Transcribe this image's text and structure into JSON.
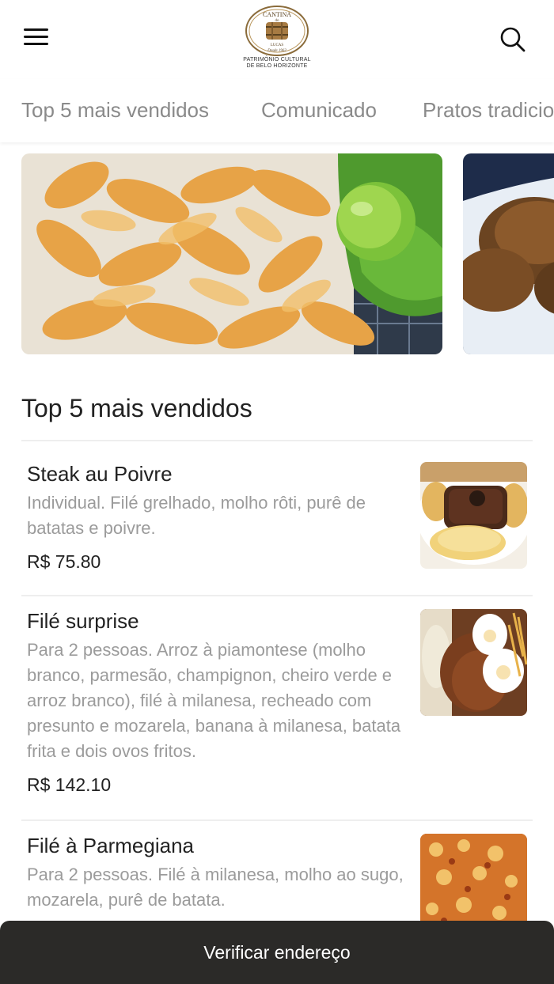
{
  "header": {
    "logo_text": "CANTINA do LUCAS",
    "logo_since": "Desde 1962",
    "logo_tagline_1": "PATRIMÔNIO CULTURAL",
    "logo_tagline_2": "DE BELO HORIZONTE",
    "menu_icon": "hamburger-menu-icon",
    "search_icon": "search-icon"
  },
  "tabs": [
    {
      "label": "Top 5 mais vendidos"
    },
    {
      "label": "Comunicado"
    },
    {
      "label": "Pratos tradicionais"
    }
  ],
  "carousel": {
    "slides": [
      {
        "image": "fried-fish-platter"
      },
      {
        "image": "breaded-croquettes"
      }
    ]
  },
  "section": {
    "title": "Top 5 mais vendidos"
  },
  "items": [
    {
      "name": "Steak au Poivre",
      "description": "Individual. Filé grelhado, molho rôti, purê de batatas e poivre.",
      "price": "R$ 75.80"
    },
    {
      "name": "Filé surprise",
      "description": "Para 2 pessoas. Arroz à piamontese (molho branco, parmesão, champignon, cheiro verde e arroz branco), filé à milanesa, recheado com presunto e mozarela, banana à milanesa, batata frita e dois ovos fritos.",
      "price": "R$ 142.10"
    },
    {
      "name": "Filé à Parmegiana",
      "description": "Para 2 pessoas. Filé à milanesa, molho ao sugo, mozarela, purê de batata.",
      "price": ""
    }
  ],
  "footer": {
    "button_label": "Verificar endereço"
  },
  "colors": {
    "footer_bg": "#2b2a28",
    "tab_text": "#8a8a8a",
    "desc_text": "#9b9b9b"
  }
}
